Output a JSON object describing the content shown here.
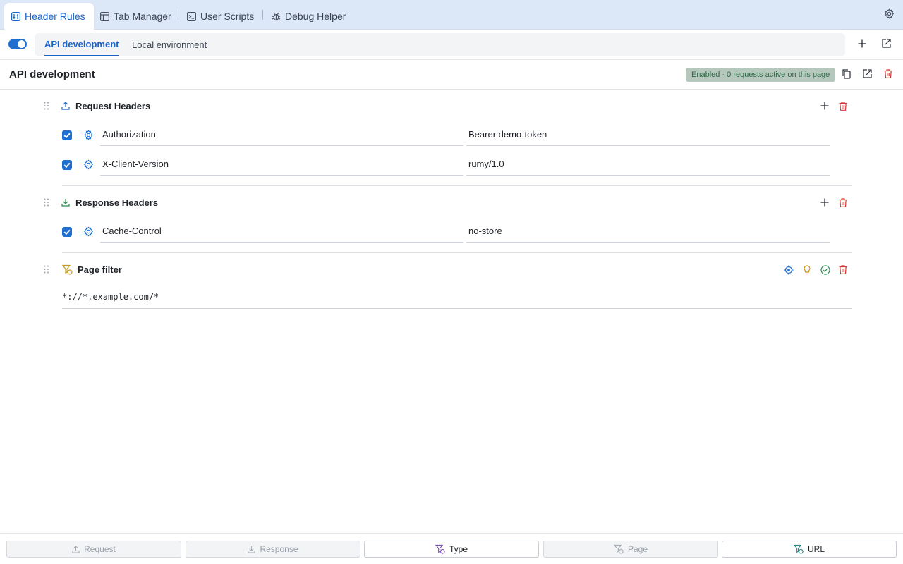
{
  "nav": {
    "tabs": [
      {
        "label": "Header Rules",
        "icon": "sliders-icon",
        "active": true
      },
      {
        "label": "Tab Manager",
        "icon": "layout-icon"
      },
      {
        "label": "User Scripts",
        "icon": "terminal-icon"
      },
      {
        "label": "Debug Helper",
        "icon": "bug-icon"
      }
    ]
  },
  "profiles": {
    "enabled": true,
    "tabs": [
      {
        "label": "API development",
        "active": true
      },
      {
        "label": "Local environment"
      }
    ]
  },
  "profile": {
    "title": "API development",
    "status": "Enabled · 0 requests active on this page"
  },
  "request_headers": {
    "title": "Request Headers",
    "rows": [
      {
        "enabled": true,
        "name": "Authorization",
        "value": "Bearer demo-token"
      },
      {
        "enabled": true,
        "name": "X-Client-Version",
        "value": "rumy/1.0"
      }
    ]
  },
  "response_headers": {
    "title": "Response Headers",
    "rows": [
      {
        "enabled": true,
        "name": "Cache-Control",
        "value": "no-store"
      }
    ]
  },
  "page_filter": {
    "title": "Page filter",
    "value": "*://*.example.com/*"
  },
  "bottom_buttons": [
    {
      "label": "Request",
      "enabled": false
    },
    {
      "label": "Response",
      "enabled": false
    },
    {
      "label": "Type",
      "enabled": true
    },
    {
      "label": "Page",
      "enabled": false
    },
    {
      "label": "URL",
      "enabled": true
    }
  ],
  "colors": {
    "accent": "#1f6fd1",
    "danger": "#d13b3b",
    "success": "#2d8a50",
    "warning": "#c99a1e"
  }
}
